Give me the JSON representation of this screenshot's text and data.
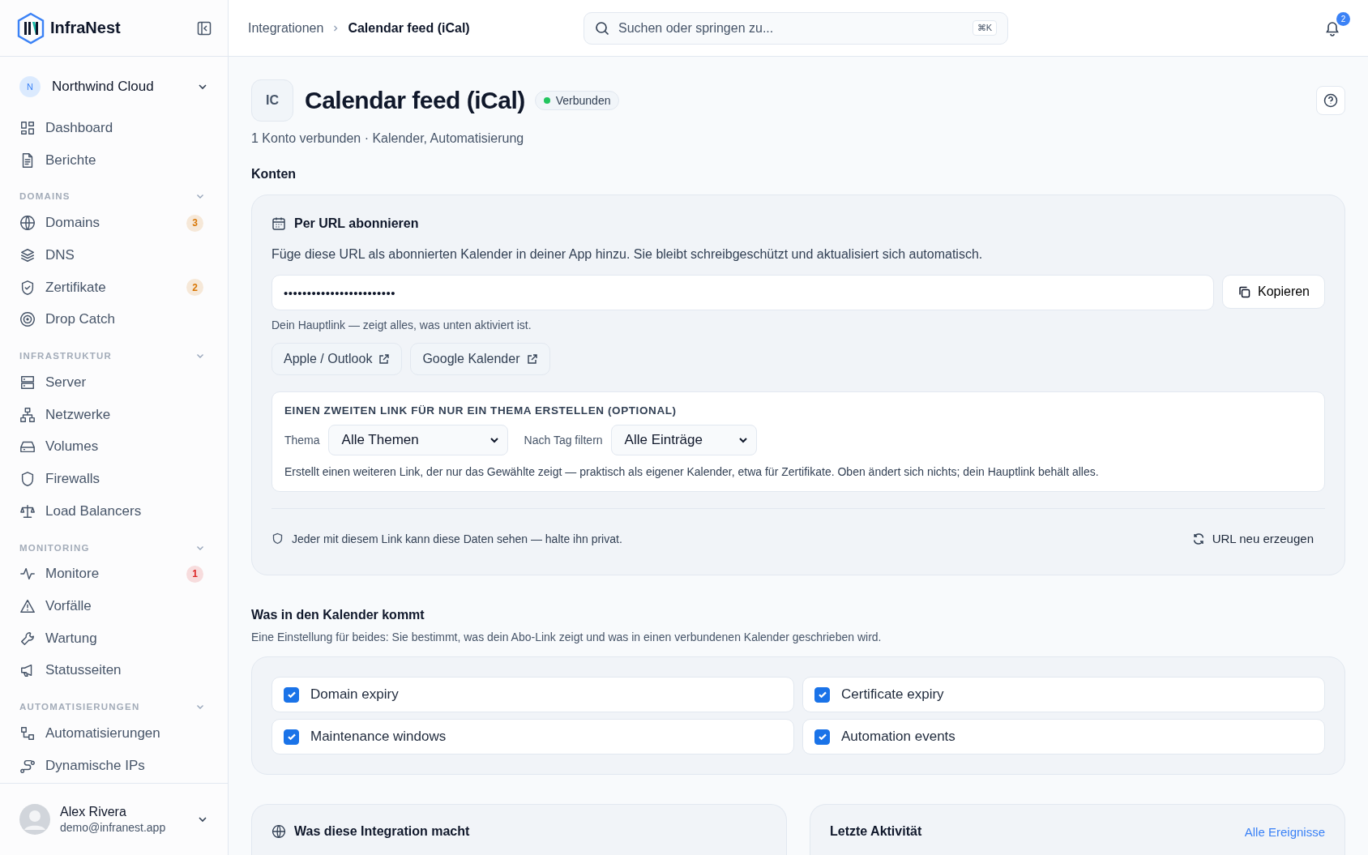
{
  "sidebar": {
    "brand": "InfraNest",
    "workspace": {
      "initial": "N",
      "name": "Northwind Cloud"
    },
    "nav": [
      {
        "label": "Dashboard"
      },
      {
        "label": "Berichte"
      }
    ],
    "sections": [
      {
        "title": "DOMAINS",
        "items": [
          {
            "label": "Domains",
            "badge": {
              "text": "3",
              "color": "#d97706"
            }
          },
          {
            "label": "DNS"
          },
          {
            "label": "Zertifikate",
            "badge": {
              "text": "2",
              "color": "#d97706"
            }
          },
          {
            "label": "Drop Catch"
          }
        ]
      },
      {
        "title": "INFRASTRUKTUR",
        "items": [
          {
            "label": "Server"
          },
          {
            "label": "Netzwerke"
          },
          {
            "label": "Volumes"
          },
          {
            "label": "Firewalls"
          },
          {
            "label": "Load Balancers"
          }
        ]
      },
      {
        "title": "MONITORING",
        "items": [
          {
            "label": "Monitore",
            "badge": {
              "text": "1",
              "color": "#dc2626"
            }
          },
          {
            "label": "Vorfälle"
          },
          {
            "label": "Wartung"
          },
          {
            "label": "Statusseiten"
          }
        ]
      },
      {
        "title": "AUTOMATISIERUNGEN",
        "items": [
          {
            "label": "Automatisierungen"
          },
          {
            "label": "Dynamische IPs"
          }
        ]
      }
    ],
    "user": {
      "name": "Alex Rivera",
      "email": "demo@infranest.app"
    }
  },
  "header": {
    "breadcrumb": [
      "Integrationen",
      "Calendar feed (iCal)"
    ],
    "search": {
      "placeholder": "Suchen oder springen zu...",
      "shortcut": "⌘K"
    },
    "notifications": "2"
  },
  "page": {
    "initials": "IC",
    "title": "Calendar feed (iCal)",
    "status": {
      "label": "Verbunden",
      "color": "#22c55e"
    },
    "subtitle": "1 Konto verbunden · Kalender, Automatisierung"
  },
  "accounts": {
    "heading": "Konten",
    "title": "Per URL abonnieren",
    "description": "Füge diese URL als abonnierten Kalender in deiner App hinzu. Sie bleibt schreibgeschützt und aktualisiert sich automatisch.",
    "url_value": "••••••••••••••••••••••••",
    "copy_button": "Kopieren",
    "hint": "Dein Hauptlink — zeigt alles, was unten aktiviert ist.",
    "links": [
      "Apple / Outlook",
      "Google Kalender"
    ],
    "topic_link": {
      "heading": "EINEN ZWEITEN LINK FÜR NUR EIN THEMA ERSTELLEN (OPTIONAL)",
      "filters": [
        {
          "label": "Thema",
          "value": "Alle Themen"
        },
        {
          "label": "Nach Tag filtern",
          "value": "Alle Einträge"
        }
      ],
      "note": "Erstellt einen weiteren Link, der nur das Gewählte zeigt — praktisch als eigener Kalender, etwa für Zertifikate. Oben ändert sich nichts; dein Hauptlink behält alles."
    },
    "privacy_note": "Jeder mit diesem Link kann diese Daten sehen — halte ihn privat.",
    "regenerate_button": "URL neu erzeugen"
  },
  "calendar": {
    "heading": "Was in den Kalender kommt",
    "description": "Eine Einstellung für beides: Sie bestimmt, was dein Abo-Link zeigt und was in einen verbundenen Kalender geschrieben wird.",
    "options": [
      {
        "label": "Domain expiry",
        "checked": true
      },
      {
        "label": "Certificate expiry",
        "checked": true
      },
      {
        "label": "Maintenance windows",
        "checked": true
      },
      {
        "label": "Automation events",
        "checked": true
      }
    ]
  },
  "bottom_cards": [
    {
      "title": "Was diese Integration macht"
    },
    {
      "title": "Letzte Aktivität",
      "link": "Alle Ereignisse"
    }
  ]
}
